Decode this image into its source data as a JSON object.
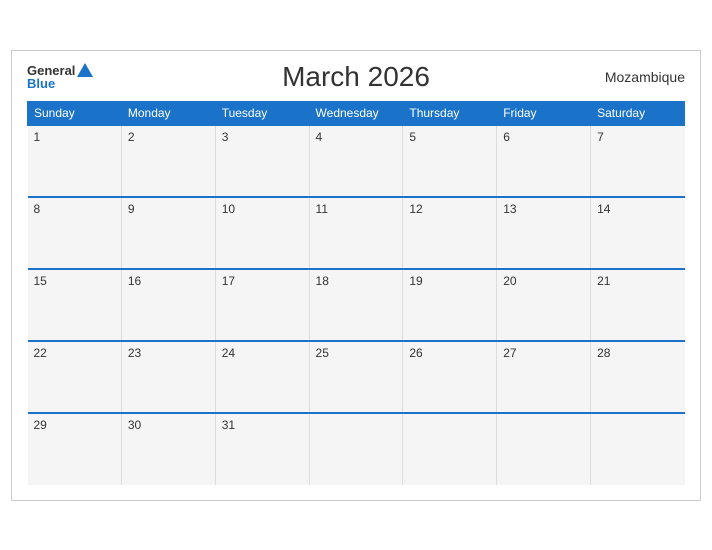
{
  "header": {
    "title": "March 2026",
    "country": "Mozambique",
    "logo_general": "General",
    "logo_blue": "Blue"
  },
  "weekdays": [
    "Sunday",
    "Monday",
    "Tuesday",
    "Wednesday",
    "Thursday",
    "Friday",
    "Saturday"
  ],
  "weeks": [
    [
      {
        "day": "1"
      },
      {
        "day": "2"
      },
      {
        "day": "3"
      },
      {
        "day": "4"
      },
      {
        "day": "5"
      },
      {
        "day": "6"
      },
      {
        "day": "7"
      }
    ],
    [
      {
        "day": "8"
      },
      {
        "day": "9"
      },
      {
        "day": "10"
      },
      {
        "day": "11"
      },
      {
        "day": "12"
      },
      {
        "day": "13"
      },
      {
        "day": "14"
      }
    ],
    [
      {
        "day": "15"
      },
      {
        "day": "16"
      },
      {
        "day": "17"
      },
      {
        "day": "18"
      },
      {
        "day": "19"
      },
      {
        "day": "20"
      },
      {
        "day": "21"
      }
    ],
    [
      {
        "day": "22"
      },
      {
        "day": "23"
      },
      {
        "day": "24"
      },
      {
        "day": "25"
      },
      {
        "day": "26"
      },
      {
        "day": "27"
      },
      {
        "day": "28"
      }
    ],
    [
      {
        "day": "29"
      },
      {
        "day": "30"
      },
      {
        "day": "31"
      },
      {
        "day": ""
      },
      {
        "day": ""
      },
      {
        "day": ""
      },
      {
        "day": ""
      }
    ]
  ]
}
